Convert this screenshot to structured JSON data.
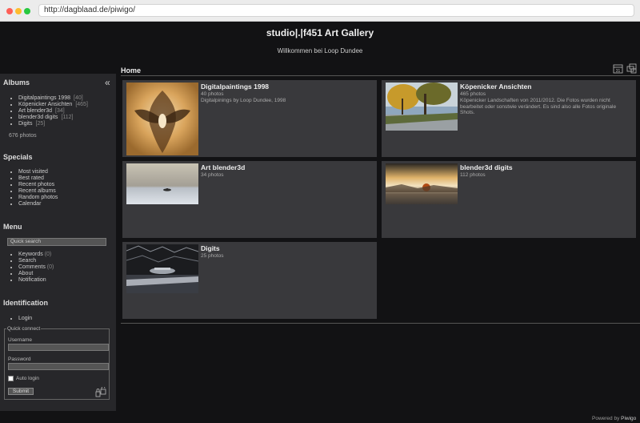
{
  "browser": {
    "url": "http://dagblaad.de/piwigo/"
  },
  "header": {
    "title": "studio|.|f451 Art Gallery",
    "subtitle": "Willkommen bei Loop Dundee"
  },
  "sidebar": {
    "collapse_icon": "«",
    "albums": {
      "heading": "Albums",
      "items": [
        {
          "label": "Digitalpaintings 1998",
          "count": "[40]"
        },
        {
          "label": "Köpenicker Ansichten",
          "count": "[465]"
        },
        {
          "label": "Art blender3d",
          "count": "[34]"
        },
        {
          "label": "blender3d digits",
          "count": "[112]"
        },
        {
          "label": "Digits",
          "count": "[25]"
        }
      ],
      "total": "676 photos"
    },
    "specials": {
      "heading": "Specials",
      "items": [
        "Most visited",
        "Best rated",
        "Recent photos",
        "Recent albums",
        "Random photos",
        "Calendar"
      ]
    },
    "menu": {
      "heading": "Menu",
      "search_placeholder": "Quick search",
      "items": [
        {
          "label": "Keywords",
          "count": "(0)"
        },
        {
          "label": "Search",
          "count": ""
        },
        {
          "label": "Comments",
          "count": "(0)"
        },
        {
          "label": "About",
          "count": ""
        },
        {
          "label": "Notification",
          "count": ""
        }
      ]
    },
    "identification": {
      "heading": "Identification",
      "login": "Login",
      "quick_connect": "Quick connect",
      "username_label": "Username",
      "password_label": "Password",
      "auto_login": "Auto login",
      "submit": "Submit"
    }
  },
  "content": {
    "title": "Home",
    "albums": [
      {
        "title": "Digitalpaintings 1998",
        "count": "40 photos",
        "description": "Digitalpinings by Loop Dundee, 1998"
      },
      {
        "title": "Köpenicker Ansichten",
        "count": "465 photos",
        "description": "Köpenicker Landschaften von 2011/2012. Die Fotos wurden nicht bearbeitet oder sonstwie verändert. Es sind also alle Fotos originale Shots."
      },
      {
        "title": "Art blender3d",
        "count": "34 photos",
        "description": ""
      },
      {
        "title": "blender3d digits",
        "count": "112 photos",
        "description": ""
      },
      {
        "title": "Digits",
        "count": "25 photos",
        "description": ""
      }
    ]
  },
  "footer": {
    "prefix": "Powered by",
    "link": "Piwigo"
  },
  "icons": [
    "calendar-icon",
    "flat-view-icon",
    "register-icon"
  ],
  "colors": {
    "background": "#121214",
    "panel": "#27272a",
    "album_card": "#39393c",
    "text": "#bbbbbb"
  }
}
